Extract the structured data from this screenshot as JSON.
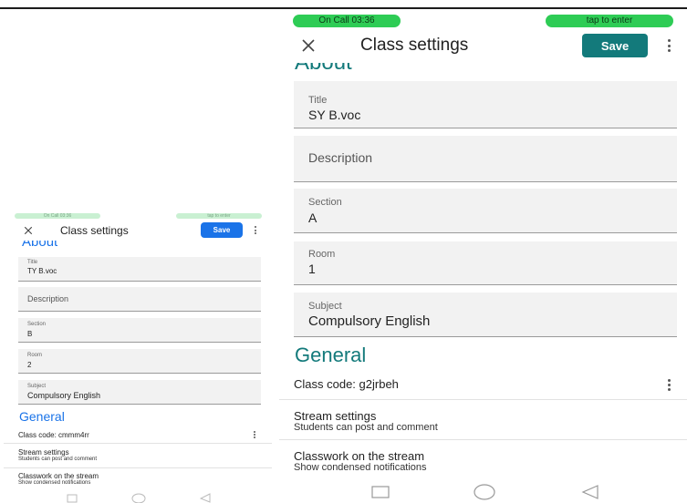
{
  "status_bar": {
    "call_pill": "On Call  03:36",
    "tap_pill": "tap to enter"
  },
  "appbar": {
    "title": "Class settings",
    "save_label": "Save",
    "close_icon": "close-icon",
    "more_icon": "more-vert-icon"
  },
  "about_heading": "About",
  "large": {
    "fields": [
      {
        "label": "Title",
        "value": "SY B.voc"
      },
      {
        "label": "",
        "value": "",
        "placeholder": "Description"
      },
      {
        "label": "Section",
        "value": "A"
      },
      {
        "label": "Room",
        "value": "1"
      },
      {
        "label": "Subject",
        "value": "Compulsory English"
      }
    ],
    "class_code": "Class code: g2jrbeh"
  },
  "small": {
    "fields": [
      {
        "label": "Title",
        "value": "TY B.voc"
      },
      {
        "label": "",
        "value": "",
        "placeholder": "Description"
      },
      {
        "label": "Section",
        "value": "B"
      },
      {
        "label": "Room",
        "value": "2"
      },
      {
        "label": "Subject",
        "value": "Compulsory English"
      }
    ],
    "class_code": "Class code: cmmm4rr"
  },
  "general_heading": "General",
  "stream_settings": {
    "title": "Stream settings",
    "subtitle": "Students can post and comment"
  },
  "classwork_stream": {
    "title": "Classwork on the stream",
    "subtitle": "Show condensed notifications"
  },
  "nav_icons": [
    "recent-apps-icon",
    "home-icon",
    "back-icon"
  ],
  "colors": {
    "accent": "#137a7b",
    "call_pill": "#2ecc55",
    "field_bg": "#f2f2f2"
  }
}
